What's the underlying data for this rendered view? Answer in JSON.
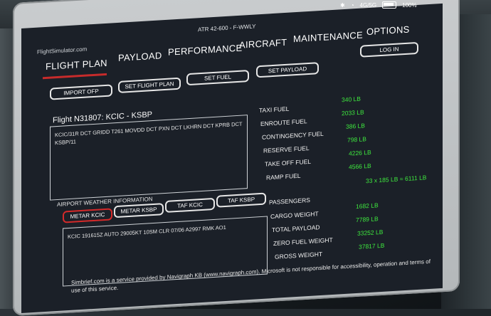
{
  "status": {
    "bluetooth": "✱",
    "wifi": "◔",
    "network": "4G/5G",
    "battery": "100%"
  },
  "header": {
    "aircraft": "ATR 42-600 - F-WWLY",
    "brand": "FlightSimulator.com"
  },
  "tabs": [
    {
      "label": "FLIGHT PLAN"
    },
    {
      "label": "PAYLOAD"
    },
    {
      "label": "PERFORMANCE"
    },
    {
      "label": "AIRCRAFT"
    },
    {
      "label": "MAINTENANCE"
    },
    {
      "label": "OPTIONS"
    }
  ],
  "login_label": "LOG IN",
  "actions": {
    "import_ofp": "IMPORT OFP",
    "set_flight_plan": "SET FLIGHT PLAN",
    "set_fuel": "SET FUEL",
    "set_payload": "SET PAYLOAD"
  },
  "flight": {
    "heading": "Flight N31807: KCIC - KSBP",
    "route": "KCIC/31R DCT GRIDD T261 MOVDD DCT PXN DCT LKHRN DCT KPRB DCT KSBP/11"
  },
  "weather": {
    "label": "AIRPORT WEATHER INFORMATION",
    "buttons": [
      "METAR KCIC",
      "METAR KSBP",
      "TAF KCIC",
      "TAF KSBP"
    ],
    "text": "KCIC 191615Z AUTO 29005KT 10SM CLR 07/06 A2997 RMK AO1"
  },
  "fuel": [
    {
      "label": "TAXI FUEL",
      "value": "340 LB"
    },
    {
      "label": "ENROUTE FUEL",
      "value": "2033 LB"
    },
    {
      "label": "CONTINGENCY FUEL",
      "value": "386 LB"
    },
    {
      "label": "RESERVE FUEL",
      "value": "798 LB"
    },
    {
      "label": "TAKE OFF FUEL",
      "value": "4226 LB"
    },
    {
      "label": "RAMP FUEL",
      "value": "4566 LB"
    }
  ],
  "passengers_calc": "33 x 185 LB = 6111 LB",
  "weights": [
    {
      "label": "PASSENGERS",
      "value": ""
    },
    {
      "label": "CARGO WEIGHT",
      "value": "1682 LB"
    },
    {
      "label": "TOTAL PAYLOAD",
      "value": "7789 LB"
    },
    {
      "label": "ZERO FUEL WEIGHT",
      "value": "33252 LB"
    },
    {
      "label": "GROSS WEIGHT",
      "value": "37817 LB"
    }
  ],
  "footer": "Simbrief.com is a service provided by Navigraph KB (www.navigraph.com). Microsoft is not responsible for accessibility, operation and terms of use of this service."
}
